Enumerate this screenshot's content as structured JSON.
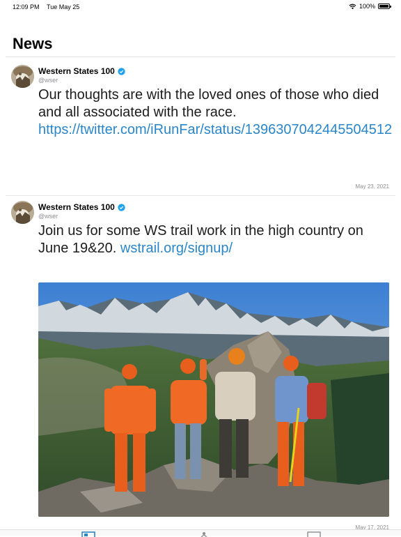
{
  "status_bar": {
    "time": "12:09 PM",
    "date": "Tue May 25",
    "battery": "100%",
    "battery_level": 1.0
  },
  "nav": {
    "title": "News"
  },
  "tweets": [
    {
      "author": "Western States 100",
      "handle": "@wser",
      "text": "Our thoughts are with the loved ones of those who died and all associated with the race.",
      "link": "https://twitter.com/iRunFar/status/1396307042445504512",
      "date": "May 23, 2021"
    },
    {
      "author": "Western States 100",
      "handle": "@wser",
      "text": "Join us for some WS trail work in the high country on June 19&20.",
      "link": "wstrail.org/signup/",
      "date": "May 17, 2021"
    }
  ],
  "icons": {
    "verified": "verified-badge-icon",
    "wifi": "wifi-icon",
    "tab_news": "news-tab-icon",
    "tab_runners": "runner-tab-icon",
    "tab_more": "more-tab-icon"
  },
  "colors": {
    "link": "#2a86c8",
    "verified": "#1da1f2",
    "divider": "#e4e4e4",
    "secondary_text": "#8e8e93"
  }
}
